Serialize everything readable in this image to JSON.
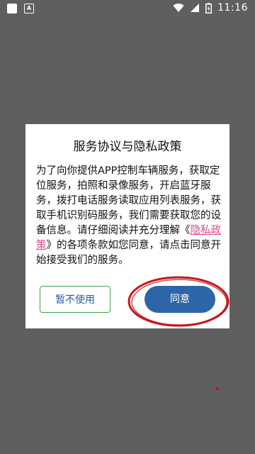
{
  "status_bar": {
    "time": "11:16",
    "icons": [
      "app-square-icon",
      "a-notification-icon",
      "wifi-icon",
      "signal-icon",
      "battery-icon"
    ]
  },
  "dialog": {
    "title": "服务协议与隐私政策",
    "body_before_link": "为了向你提供APP控制车辆服务，获取定位服务，拍照和录像服务，开启蓝牙服务，拨打电话服务读取应用列表服务，获取手机识别码服务，我们需要获取您的设备信息。请仔细阅读并充分理解《",
    "link_text": "隐私政策",
    "body_after_link": "》的各项条款如您同意，请点击同意开始接受我们的服务。",
    "decline_label": "暂不使用",
    "agree_label": "同意"
  },
  "colors": {
    "overlay": "#5f5f5f",
    "agree_button": "#2c66a8",
    "decline_border": "#3aa848",
    "link": "#e0458a",
    "highlight": "#c8141e"
  }
}
